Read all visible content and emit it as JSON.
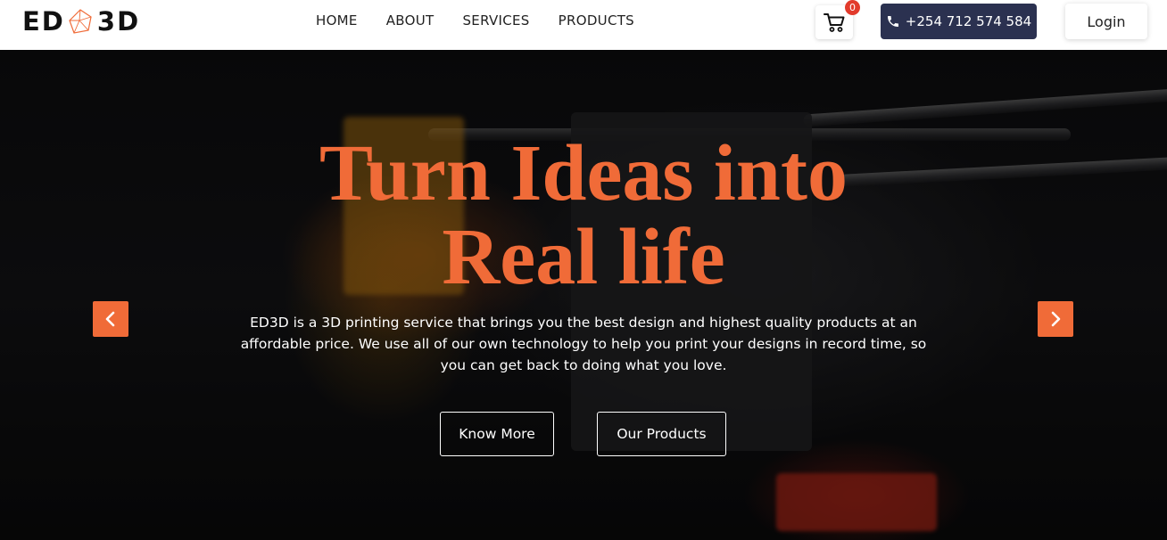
{
  "brand": {
    "logo_left": "ED",
    "logo_right": "3D",
    "accent": "#f06b38",
    "dark": "#2b3150"
  },
  "nav": {
    "items": [
      "HOME",
      "ABOUT",
      "SERVICES",
      "PRODUCTS"
    ]
  },
  "cart": {
    "count": "0",
    "icon": "cart-icon"
  },
  "phone": {
    "icon": "phone-icon",
    "label": "+254 712 574 584"
  },
  "login": {
    "label": "Login"
  },
  "hero": {
    "title_line1": "Turn Ideas into",
    "title_line2": "Real life",
    "description": "ED3D is a 3D printing service that brings you the best design and highest quality products at an affordable price. We use all of our own technology to help you print your designs in record time, so you can get back to doing what you love.",
    "buttons": {
      "know_more": "Know More",
      "our_products": "Our Products"
    },
    "prev_icon": "chevron-left-icon",
    "next_icon": "chevron-right-icon"
  }
}
